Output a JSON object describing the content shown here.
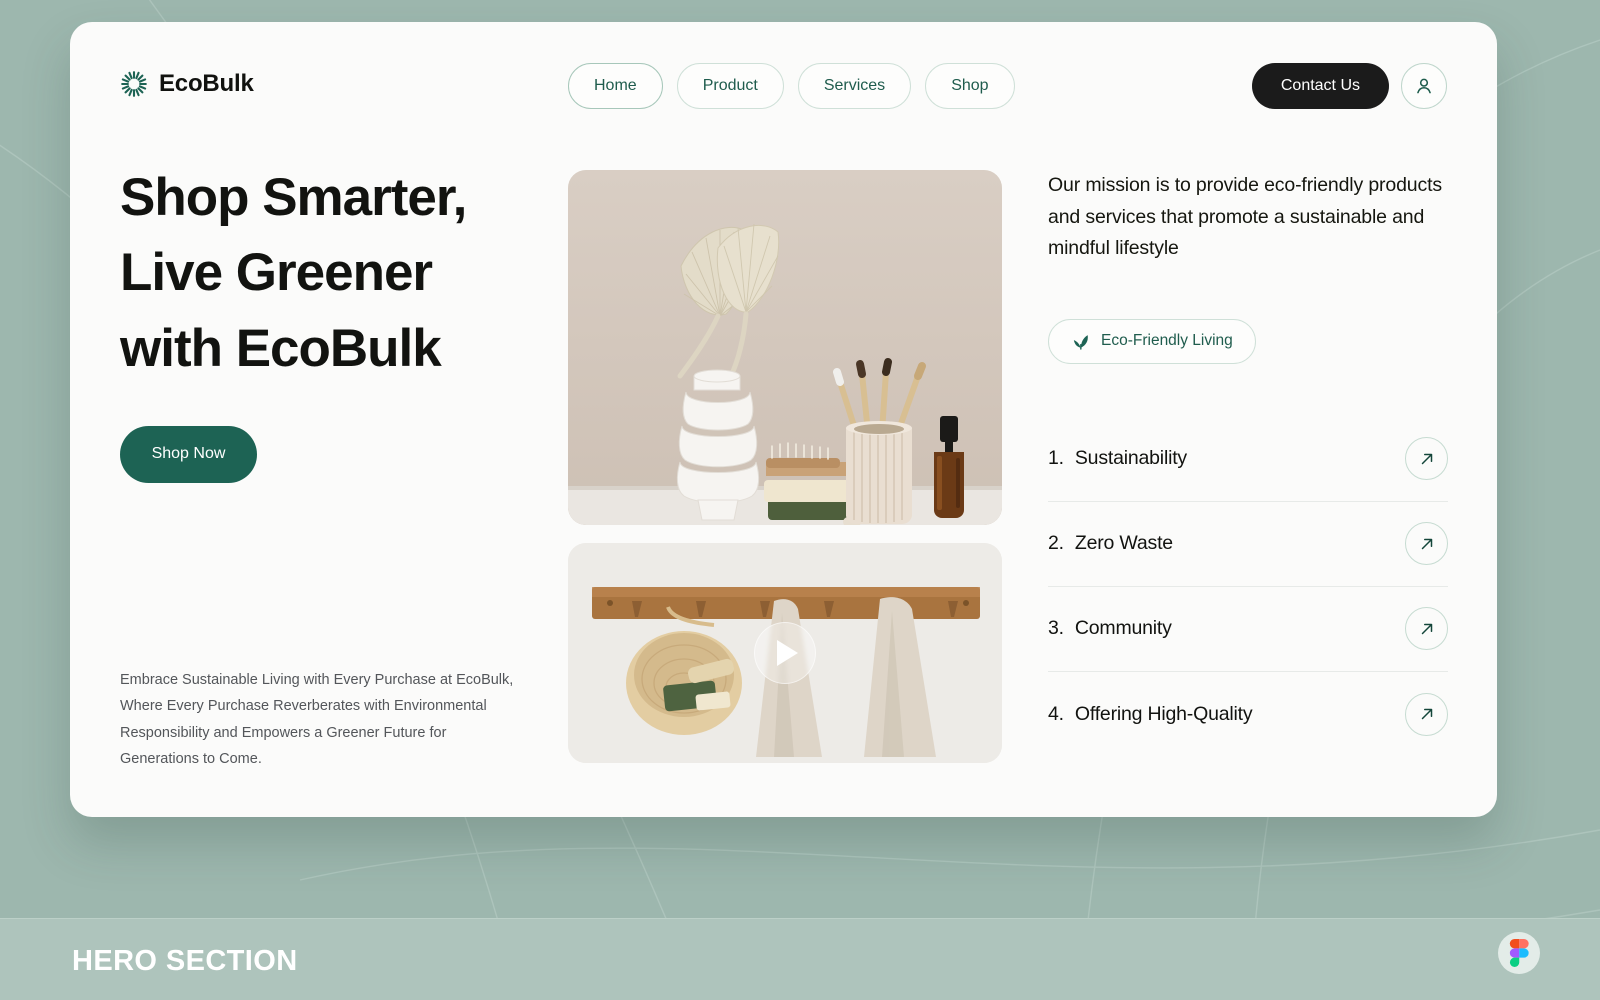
{
  "theme": {
    "page_background": "#9db7ae",
    "card_background": "#fbfbfa",
    "brand_green": "#1d6354",
    "accent_border": "#cfe0d8",
    "dark_button": "#1b1b1b",
    "bottom_bar": "#aec4bc"
  },
  "header": {
    "logo_icon": "starburst-icon",
    "brand_name": "EcoBulk",
    "nav_items": [
      {
        "label": "Home",
        "active": true
      },
      {
        "label": "Product",
        "active": false
      },
      {
        "label": "Services",
        "active": false
      },
      {
        "label": "Shop",
        "active": false
      }
    ],
    "contact_label": "Contact Us",
    "avatar_icon": "user-icon"
  },
  "hero": {
    "headline_line1": "Shop Smarter,",
    "headline_line2": "Live Greener",
    "headline_line3": "with EcoBulk",
    "cta_label": "Shop Now",
    "description": "Embrace Sustainable Living with Every Purchase at EcoBulk, Where Every Purchase Reverberates with Environmental Responsibility and Empowers a Greener Future for Generations to Come."
  },
  "media": {
    "top_image_alt": "eco bathroom products: white ribbed vase with dried palm leaves, soap bars, wooden brush, bamboo toothbrushes in ribbed cup, amber dropper bottle",
    "bottom_image_alt": "wooden peg rail with woven basket holding soap and brush, two beige towels hanging",
    "play_icon": "play-icon"
  },
  "right": {
    "mission": "Our mission is to provide eco-friendly products and services that promote a sustainable and mindful lifestyle",
    "badge": {
      "icon": "leaf-icon",
      "label": "Eco-Friendly Living"
    },
    "features": [
      {
        "number": "1.",
        "label": "Sustainability",
        "arrow_icon": "arrow-up-right-icon"
      },
      {
        "number": "2.",
        "label": "Zero Waste",
        "arrow_icon": "arrow-up-right-icon"
      },
      {
        "number": "3.",
        "label": "Community",
        "arrow_icon": "arrow-up-right-icon"
      },
      {
        "number": "4.",
        "label": "Offering High-Quality",
        "arrow_icon": "arrow-up-right-icon"
      }
    ]
  },
  "footer": {
    "section_label": "HERO SECTION",
    "badge_icon": "figma-icon"
  }
}
